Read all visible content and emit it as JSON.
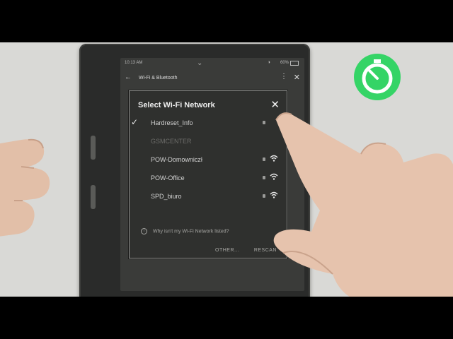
{
  "status_bar": {
    "time": "10:13 AM",
    "battery": "60%"
  },
  "app_bar": {
    "title": "Wi-Fi & Bluetooth"
  },
  "dialog": {
    "title": "Select Wi-Fi Network",
    "networks": [
      {
        "name": "Hardreset_Info",
        "connected": true
      },
      {
        "name": "GSMCENTER",
        "connected": false
      },
      {
        "name": "POW-Domowniczł",
        "connected": false
      },
      {
        "name": "POW-Office",
        "connected": false
      },
      {
        "name": "SPD_biuro",
        "connected": false
      }
    ],
    "help_text": "Why isn't my Wi-Fi Network listed?",
    "other_label": "OTHER...",
    "rescan_label": "RESCAN"
  },
  "colors": {
    "sticker_green": "#35d466",
    "skin": "#e6c3ad"
  }
}
